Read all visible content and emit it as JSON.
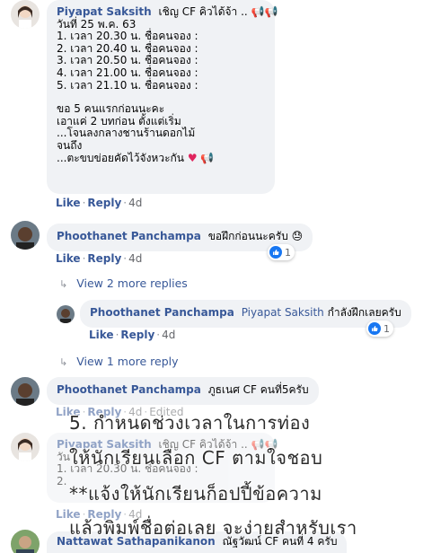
{
  "thread": {
    "comments": [
      {
        "author": "Piyapat Saksith",
        "text_lines": [
          "เชิญ CF คิวได้จ้า ..",
          "วันที่ 25 พ.ค. 63",
          "1. เวลา 20.30 น. ชื่อคนจอง :",
          "2. เวลา 20.40 น. ชื่อคนจอง :",
          "3. เวลา 20.50 น. ชื่อคนจอง :",
          "4. เวลา 21.00 น. ชื่อคนจอง :",
          "5. เวลา 21.10 น. ชื่อคนจอง :",
          "",
          "ขอ 5 คนแรกก่อนนะคะ",
          "เอาแค่ 2 บทก่อน ตั้งแต่เริ่ม",
          "...โจนลงกลางชานร้านดอกไม้",
          "จนถึง",
          "...ตะขบข่อยคัดไว้จังหวะกัน"
        ],
        "like_label": "Like",
        "reply_label": "Reply",
        "time": "4d"
      },
      {
        "author": "Phoothanet Panchampa",
        "text": "ขอฝึกก่อนนะครับ",
        "like_label": "Like",
        "reply_label": "Reply",
        "time": "4d",
        "reaction_count": "1"
      },
      {
        "view_replies": "View 2 more replies"
      },
      {
        "author": "Phoothanet Panchampa",
        "mention": "Piyapat Saksith",
        "text": "กำลังฝึกเลยครับ",
        "like_label": "Like",
        "reply_label": "Reply",
        "time": "4d",
        "reaction_count": "1"
      },
      {
        "view_replies": "View 1 more reply"
      },
      {
        "author": "Phoothanet Panchampa",
        "text": "ภูธเนศ CF คนที่5ครับ",
        "like_label": "Like",
        "reply_label": "Reply",
        "time": "4d",
        "edited": "Edited"
      },
      {
        "author": "Piyapat Saksith",
        "text": "เชิญ CF คิวได้จ้า ..",
        "line2": "วัน",
        "line3": "1. เวลา 20.30 น. ชื่อคนจอง :",
        "line4": "2."
      },
      {
        "like_label": "Like",
        "reply_label": "Reply",
        "time": "4d"
      },
      {
        "author": "Nattawat Sathapanikanon",
        "text": "ณัฐวัฒน์ CF คนที่ 4 ครับ"
      }
    ]
  },
  "overlay_caption": {
    "line1": "5. กำหนดช่วงเวลาในการท่อง",
    "line2": "ให้นักเรียนเลือก CF ตามใจชอบ",
    "line3": "**แจ้งให้นักเรียนก็อปปี้ข้อความ",
    "line4": "แล้วพิมพ์ชื่อต่อเลย จะง่ายสำหรับเรา"
  },
  "colors": {
    "link": "#385898",
    "bubble": "#f0f2f5",
    "like_blue": "#1877f2"
  }
}
